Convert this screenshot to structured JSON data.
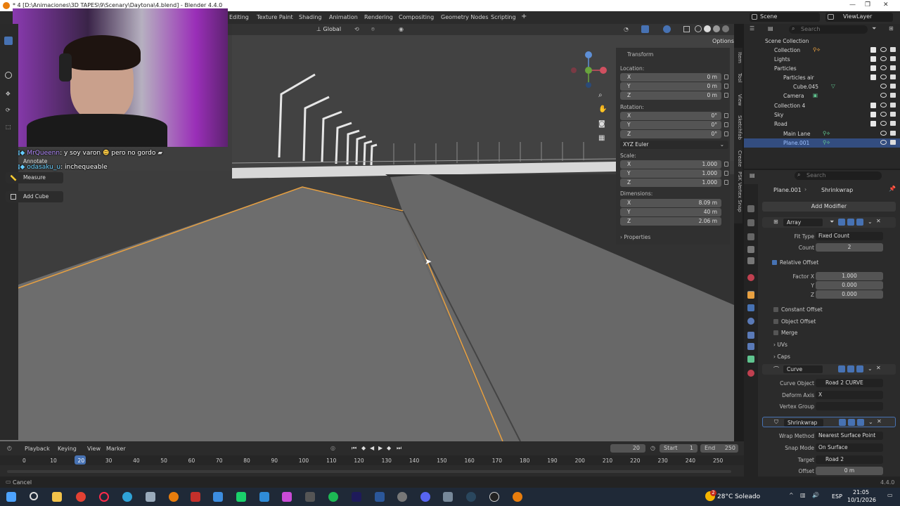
{
  "window": {
    "title": "* 4 [D:\\Animaciones\\3D TAPES\\9\\Scenary\\Daytona\\4.blend] - Blender 4.4.0"
  },
  "workspaces": [
    "Editing",
    "Texture Paint",
    "Shading",
    "Animation",
    "Rendering",
    "Compositing",
    "Geometry Nodes",
    "Scripting"
  ],
  "add_workspace": "+",
  "topbar": {
    "scene_label": "Scene",
    "viewlayer_label": "ViewLayer"
  },
  "viewport_header": {
    "orientation": "Global",
    "options": "Options"
  },
  "chat": [
    {
      "user": "MrQueenn",
      "text": ": y soy varon",
      "text2": "pero no gordo",
      "user_color": "#b48cff"
    },
    {
      "user": "odasaku_u",
      "text": ": inchequeable",
      "text2": "",
      "user_color": "#6ad1ff"
    }
  ],
  "tools": {
    "annotate": "Annotate",
    "measure": "Measure",
    "add_cube": "Add Cube"
  },
  "npanel": {
    "transform": "Transform",
    "location": "Location:",
    "loc": [
      {
        "k": "X",
        "v": "0 m"
      },
      {
        "k": "Y",
        "v": "0 m"
      },
      {
        "k": "Z",
        "v": "0 m"
      }
    ],
    "rotation": "Rotation:",
    "rot": [
      {
        "k": "X",
        "v": "0°"
      },
      {
        "k": "Y",
        "v": "0°"
      },
      {
        "k": "Z",
        "v": "0°"
      }
    ],
    "rot_mode": "XYZ Euler",
    "scale": "Scale:",
    "scl": [
      {
        "k": "X",
        "v": "1.000"
      },
      {
        "k": "Y",
        "v": "1.000"
      },
      {
        "k": "Z",
        "v": "1.000"
      }
    ],
    "dimensions": "Dimensions:",
    "dim": [
      {
        "k": "X",
        "v": "8.09 m"
      },
      {
        "k": "Y",
        "v": "40 m"
      },
      {
        "k": "Z",
        "v": "2.06 m"
      }
    ],
    "properties": "Properties"
  },
  "side_tabs": [
    "Item",
    "Tool",
    "View",
    "Sketchfab",
    "Create",
    "PSK Vertex Snap"
  ],
  "outliner": {
    "search_placeholder": "Search",
    "items": [
      {
        "name": "Scene Collection"
      },
      {
        "name": "Collection"
      },
      {
        "name": "Lights"
      },
      {
        "name": "Particles"
      },
      {
        "name": "Particles air"
      },
      {
        "name": "Cube.045"
      },
      {
        "name": "Camera"
      },
      {
        "name": "Collection 4"
      },
      {
        "name": "Sky"
      },
      {
        "name": "Road"
      },
      {
        "name": "Main Lane"
      },
      {
        "name": "Plane.001"
      }
    ]
  },
  "properties": {
    "search_placeholder": "Search",
    "object": "Plane.001",
    "modifier_path": "Shrinkwrap",
    "add_modifier": "Add Modifier",
    "array": {
      "name": "Array",
      "fit_type_label": "Fit Type",
      "fit_type": "Fixed Count",
      "count_label": "Count",
      "count": "2",
      "relative_offset": "Relative Offset",
      "factor_x_label": "Factor X",
      "factor_x": "1.000",
      "y_label": "Y",
      "y": "0.000",
      "z_label": "Z",
      "z": "0.000",
      "constant_offset": "Constant Offset",
      "object_offset": "Object Offset",
      "merge": "Merge",
      "uvs": "UVs",
      "caps": "Caps"
    },
    "curve": {
      "name": "Curve",
      "curve_object_label": "Curve Object",
      "curve_object": "Road 2 CURVE",
      "deform_axis_label": "Deform Axis",
      "deform_axis": "X",
      "vertex_group_label": "Vertex Group"
    },
    "shrinkwrap": {
      "name": "Shrinkwrap",
      "wrap_method_label": "Wrap Method",
      "wrap_method": "Nearest Surface Point",
      "snap_mode_label": "Snap Mode",
      "snap_mode": "On Surface",
      "target_label": "Target",
      "target": "Road 2",
      "offset_label": "Offset",
      "offset": "0 m"
    }
  },
  "timeline": {
    "playback": "Playback",
    "keying": "Keying",
    "view": "View",
    "marker": "Marker",
    "current_frame": "20",
    "start_label": "Start",
    "start": "1",
    "end_label": "End",
    "end": "250",
    "ticks": [
      "0",
      "10",
      "20",
      "30",
      "40",
      "50",
      "60",
      "70",
      "80",
      "90",
      "100",
      "110",
      "120",
      "130",
      "140",
      "150",
      "160",
      "170",
      "180",
      "190",
      "200",
      "210",
      "220",
      "230",
      "240",
      "250"
    ]
  },
  "status": {
    "left": "Cancel",
    "version": "4.4.0"
  },
  "taskbar": {
    "weather": "28°C  Soleado",
    "lang": "ESP",
    "time": "21:05",
    "date": "10/1/2026",
    "notif_count": "2"
  }
}
